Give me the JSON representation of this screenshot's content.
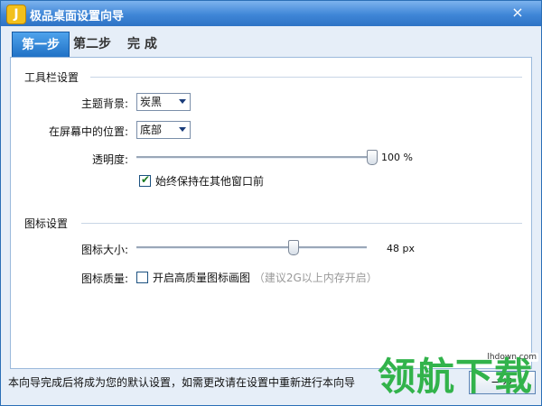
{
  "window": {
    "title": "极品桌面设置向导",
    "close_symbol": "×",
    "app_icon": "J"
  },
  "tabs": {
    "step1": "第一步",
    "step2": "第二步",
    "step3": "完 成"
  },
  "toolbar_section": {
    "title": "工具栏设置",
    "theme_label": "主题背景:",
    "theme_value": "炭黑",
    "position_label": "在屏幕中的位置:",
    "position_value": "底部",
    "opacity_label": "透明度:",
    "opacity_value_text": "100 %",
    "opacity_fraction": 1.0,
    "keep_front_label": "始终保持在其他窗口前",
    "keep_front_checked": true
  },
  "icon_section": {
    "title": "图标设置",
    "size_label": "图标大小:",
    "size_value_text": "48 px",
    "size_fraction": 0.68,
    "quality_label": "图标质量:",
    "quality_checkbox_label": "开启高质量图标画图",
    "quality_hint": "（建议2G以上内存开启）",
    "quality_checked": false
  },
  "footer": {
    "text": "本向导完成后将成为您的默认设置，如需更改请在设置中重新进行本向导",
    "next_label": "一步"
  },
  "watermark": {
    "site": "lhdown.com",
    "text": "领航下载"
  },
  "colors": {
    "accent": "#2e73c5",
    "tab_active": "#1e6fc4",
    "watermark": "#32b34b"
  }
}
